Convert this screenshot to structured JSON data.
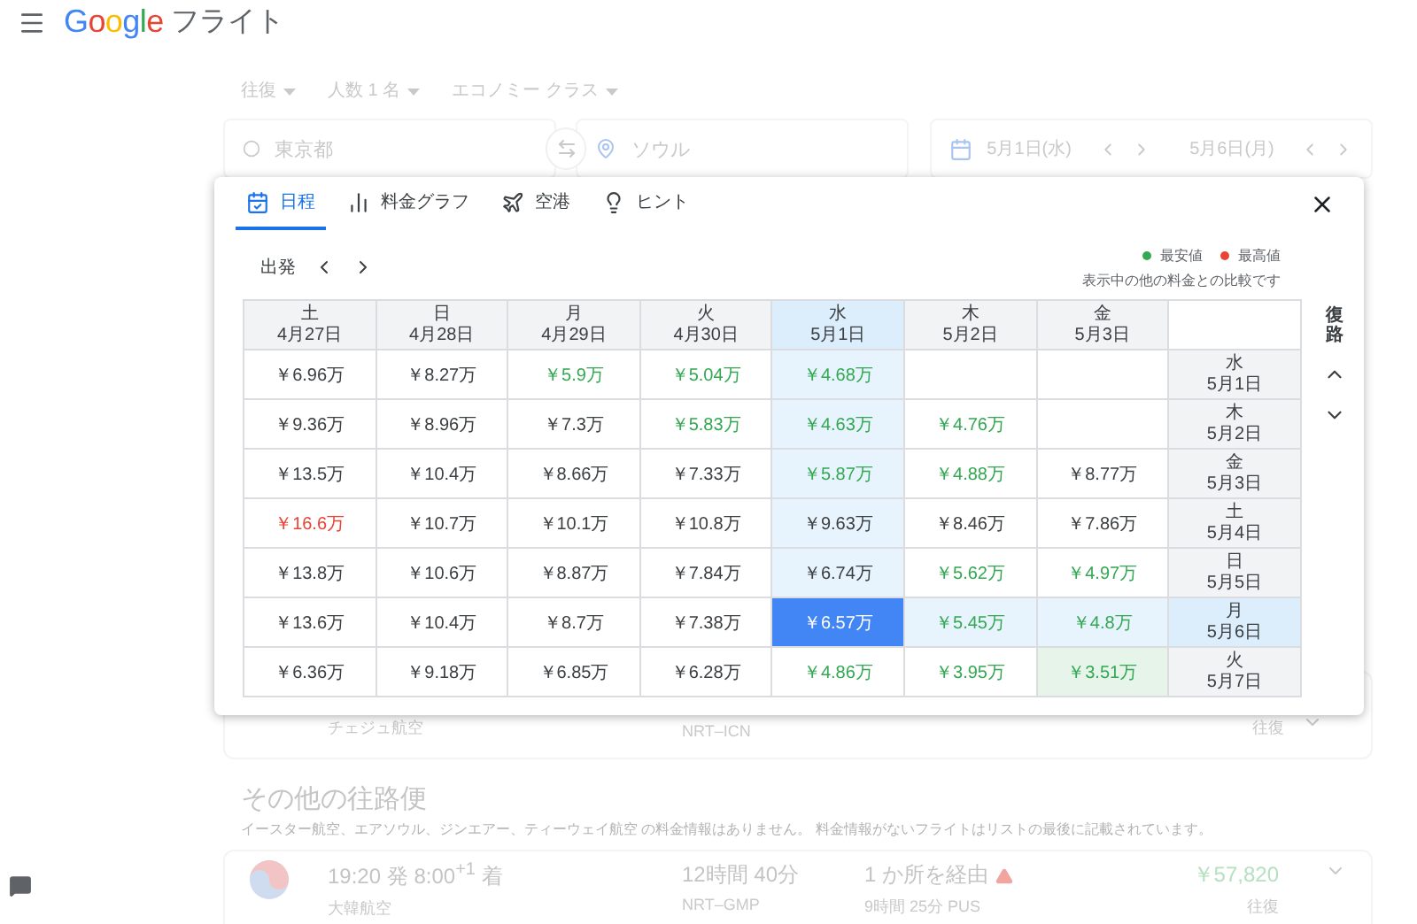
{
  "header": {
    "logo": "Google",
    "title": "フライト"
  },
  "search": {
    "trip_type": "往復",
    "passengers": "人数 1 名",
    "cabin": "エコノミー クラス",
    "origin": "東京都",
    "destination": "ソウル",
    "depart_date": "5月1日(水)",
    "return_date": "5月6日(月)"
  },
  "dialog": {
    "tabs": [
      {
        "label": "日程",
        "selected": true
      },
      {
        "label": "料金グラフ",
        "selected": false
      },
      {
        "label": "空港",
        "selected": false
      },
      {
        "label": "ヒント",
        "selected": false
      }
    ],
    "depart_label": "出発",
    "legend": [
      {
        "label": "最安値",
        "color": "#34a853"
      },
      {
        "label": "最高値",
        "color": "#ea4335"
      }
    ],
    "legend_note": "表示中の他の料金との比較です",
    "return_label": "復路",
    "columns": [
      {
        "weekday": "土",
        "date": "4月27日",
        "selected": false
      },
      {
        "weekday": "日",
        "date": "4月28日",
        "selected": false
      },
      {
        "weekday": "月",
        "date": "4月29日",
        "selected": false
      },
      {
        "weekday": "火",
        "date": "4月30日",
        "selected": false
      },
      {
        "weekday": "水",
        "date": "5月1日",
        "selected": true
      },
      {
        "weekday": "木",
        "date": "5月2日",
        "selected": false
      },
      {
        "weekday": "金",
        "date": "5月3日",
        "selected": false
      }
    ],
    "rows": [
      {
        "weekday": "水",
        "date": "5月1日",
        "selected": false,
        "cells": [
          {
            "price": "￥6.96万",
            "kind": "normal"
          },
          {
            "price": "￥8.27万",
            "kind": "normal"
          },
          {
            "price": "￥5.9万",
            "kind": "low"
          },
          {
            "price": "￥5.04万",
            "kind": "low"
          },
          {
            "price": "￥4.68万",
            "kind": "low"
          },
          {
            "kind": "empty"
          },
          {
            "kind": "empty"
          }
        ]
      },
      {
        "weekday": "木",
        "date": "5月2日",
        "selected": false,
        "cells": [
          {
            "price": "￥9.36万",
            "kind": "normal"
          },
          {
            "price": "￥8.96万",
            "kind": "normal"
          },
          {
            "price": "￥7.3万",
            "kind": "normal"
          },
          {
            "price": "￥5.83万",
            "kind": "low"
          },
          {
            "price": "￥4.63万",
            "kind": "low"
          },
          {
            "price": "￥4.76万",
            "kind": "low"
          },
          {
            "kind": "empty"
          }
        ]
      },
      {
        "weekday": "金",
        "date": "5月3日",
        "selected": false,
        "cells": [
          {
            "price": "￥13.5万",
            "kind": "normal"
          },
          {
            "price": "￥10.4万",
            "kind": "normal"
          },
          {
            "price": "￥8.66万",
            "kind": "normal"
          },
          {
            "price": "￥7.33万",
            "kind": "normal"
          },
          {
            "price": "￥5.87万",
            "kind": "low"
          },
          {
            "price": "￥4.88万",
            "kind": "low"
          },
          {
            "price": "￥8.77万",
            "kind": "normal"
          }
        ]
      },
      {
        "weekday": "土",
        "date": "5月4日",
        "selected": false,
        "cells": [
          {
            "price": "￥16.6万",
            "kind": "high"
          },
          {
            "price": "￥10.7万",
            "kind": "normal"
          },
          {
            "price": "￥10.1万",
            "kind": "normal"
          },
          {
            "price": "￥10.8万",
            "kind": "normal"
          },
          {
            "price": "￥9.63万",
            "kind": "normal"
          },
          {
            "price": "￥8.46万",
            "kind": "normal"
          },
          {
            "price": "￥7.86万",
            "kind": "normal"
          }
        ]
      },
      {
        "weekday": "日",
        "date": "5月5日",
        "selected": false,
        "cells": [
          {
            "price": "￥13.8万",
            "kind": "normal"
          },
          {
            "price": "￥10.6万",
            "kind": "normal"
          },
          {
            "price": "￥8.87万",
            "kind": "normal"
          },
          {
            "price": "￥7.84万",
            "kind": "normal"
          },
          {
            "price": "￥6.74万",
            "kind": "normal"
          },
          {
            "price": "￥5.62万",
            "kind": "low"
          },
          {
            "price": "￥4.97万",
            "kind": "low"
          }
        ]
      },
      {
        "weekday": "月",
        "date": "5月6日",
        "selected": true,
        "cells": [
          {
            "price": "￥13.6万",
            "kind": "normal"
          },
          {
            "price": "￥10.4万",
            "kind": "normal"
          },
          {
            "price": "￥8.7万",
            "kind": "normal"
          },
          {
            "price": "￥7.38万",
            "kind": "normal"
          },
          {
            "price": "￥6.57万",
            "kind": "normal"
          },
          {
            "price": "￥5.45万",
            "kind": "low"
          },
          {
            "price": "￥4.8万",
            "kind": "low"
          }
        ]
      },
      {
        "weekday": "火",
        "date": "5月7日",
        "selected": false,
        "cells": [
          {
            "price": "￥6.36万",
            "kind": "normal"
          },
          {
            "price": "￥9.18万",
            "kind": "normal"
          },
          {
            "price": "￥6.85万",
            "kind": "normal"
          },
          {
            "price": "￥6.28万",
            "kind": "normal"
          },
          {
            "price": "￥4.86万",
            "kind": "low"
          },
          {
            "price": "￥3.95万",
            "kind": "low"
          },
          {
            "price": "￥3.51万",
            "kind": "lowest"
          }
        ]
      }
    ]
  },
  "flights": [
    {
      "airline": "チェジュ航空",
      "route": "NRT–ICN",
      "fare_type": "往復"
    }
  ],
  "other_flights": {
    "heading": "その他の往路便",
    "note": "イースター航空、エアソウル、ジンエアー、ティーウェイ航空 の料金情報はありません。 料金情報がないフライトはリストの最後に記載されています。",
    "items": [
      {
        "times": "19:20 発 8:00$^{+1}$ 着",
        "airline": "大韓航空",
        "duration": "12時間 40分",
        "route": "NRT–GMP",
        "stops": "1 か所を経由",
        "layover": "9時間 25分 PUS",
        "price": "￥57,820",
        "fare_type": "往復"
      }
    ]
  }
}
